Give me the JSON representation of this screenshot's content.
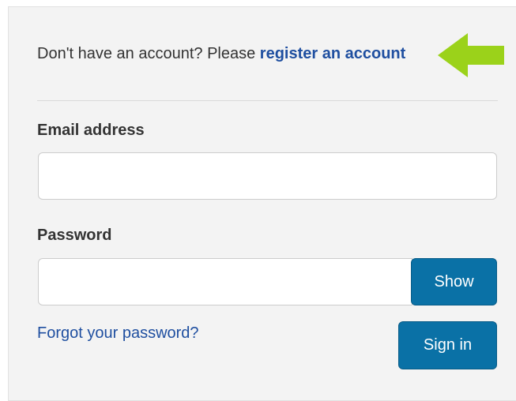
{
  "register": {
    "prefix": "Don't have an account? Please ",
    "link_label": "register an account"
  },
  "email": {
    "label": "Email address",
    "value": "",
    "placeholder": ""
  },
  "password": {
    "label": "Password",
    "value": "",
    "placeholder": "",
    "show_label": "Show"
  },
  "forgot_label": "Forgot your password?",
  "signin_label": "Sign in",
  "colors": {
    "accent": "#0a71a6",
    "link": "#1f4fa0",
    "arrow": "#9bd21a",
    "panel_bg": "#f3f3f3"
  },
  "icons": {
    "annotation": "arrow-left-icon"
  }
}
